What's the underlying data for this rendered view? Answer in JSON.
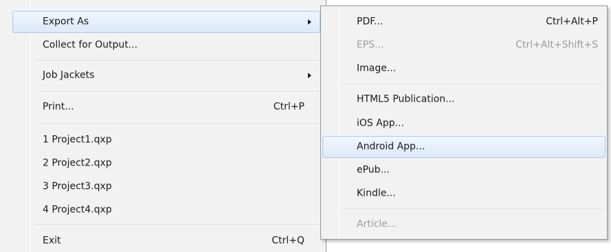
{
  "file_menu": {
    "items": [
      {
        "label": "Export As",
        "has_submenu": true,
        "highlighted": true
      },
      {
        "label": "Collect for Output..."
      },
      {
        "label": "Job Jackets",
        "has_submenu": true
      },
      {
        "label": "Print...",
        "shortcut": "Ctrl+P"
      },
      {
        "label": "1 Project1.qxp"
      },
      {
        "label": "2 Project2.qxp"
      },
      {
        "label": "3 Project3.qxp"
      },
      {
        "label": "4 Project4.qxp"
      },
      {
        "label": "Exit",
        "shortcut": "Ctrl+Q"
      }
    ]
  },
  "export_submenu": {
    "items": [
      {
        "label": "PDF...",
        "shortcut": "Ctrl+Alt+P"
      },
      {
        "label": "EPS...",
        "shortcut": "Ctrl+Alt+Shift+S",
        "disabled": true
      },
      {
        "label": "Image..."
      },
      {
        "label": "HTML5 Publication..."
      },
      {
        "label": "iOS App..."
      },
      {
        "label": "Android App...",
        "highlighted": true
      },
      {
        "label": "ePub..."
      },
      {
        "label": "Kindle..."
      },
      {
        "label": "Article...",
        "disabled": true
      }
    ]
  },
  "colors": {
    "menu_bg": "#f2f2f2",
    "highlight_border": "#a8c8ee",
    "highlight_fill": "#dde9f8",
    "disabled_text": "#9c9c9c"
  }
}
